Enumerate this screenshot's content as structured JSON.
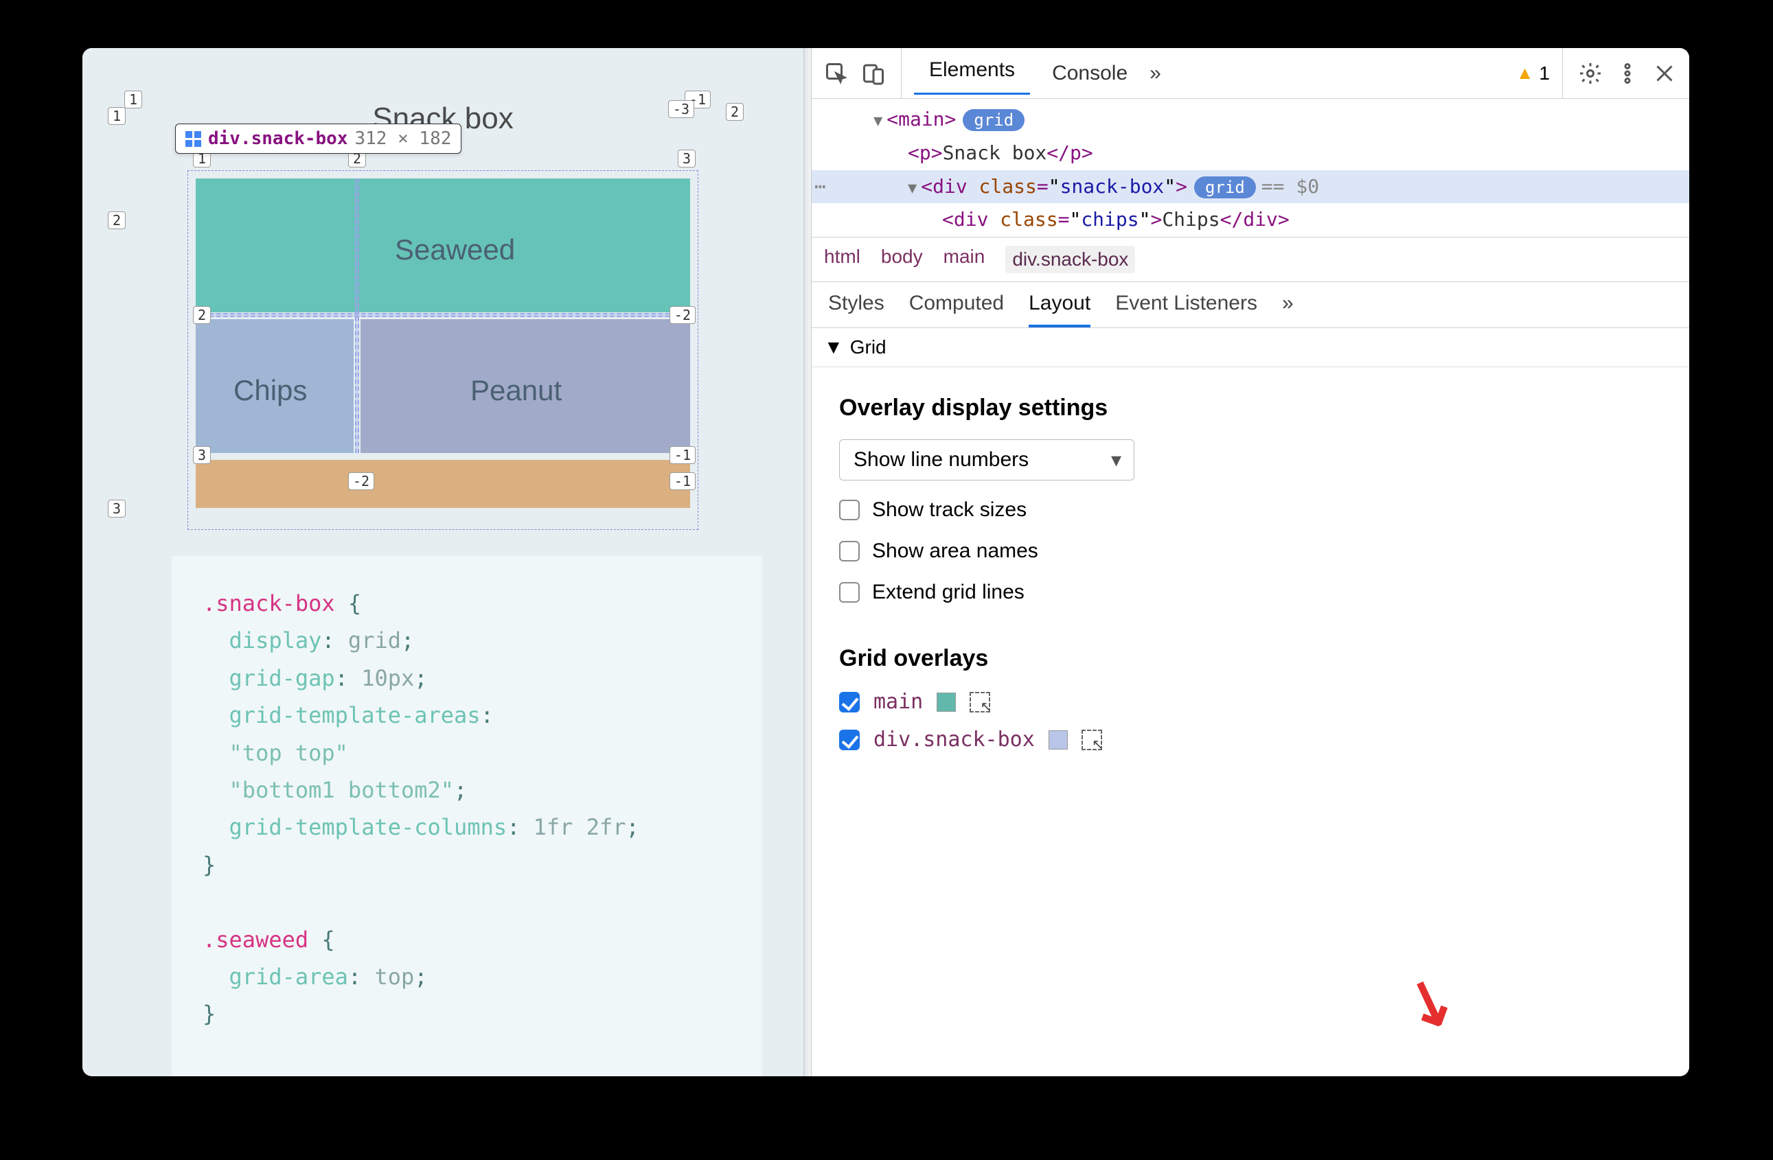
{
  "left": {
    "title": "Snack box",
    "tooltip": {
      "selector": "div.snack-box",
      "dims": "312 × 182"
    },
    "cells": {
      "seaweed": "Seaweed",
      "chips": "Chips",
      "peanut": "Peanut"
    },
    "lineNums": {
      "tl_c": "1",
      "tr_c_neg": "-1",
      "trc_col": "2",
      "r1_row": "1",
      "r2_row": "2",
      "innerTL_c": "1",
      "innerTM_c": "2",
      "innerTR_neg": "-3",
      "innerTR_c": "3",
      "innerML_r": "2",
      "innerMR_neg": "-2",
      "innerBL_r": "3",
      "innerBR_neg": "-1",
      "outerBL_r": "3",
      "outerBM_col": "-2",
      "outerBR_neg": "-1"
    },
    "code": ".snack-box {\n  display: grid;\n  grid-gap: 10px;\n  grid-template-areas:\n  \"top top\"\n  \"bottom1 bottom2\";\n  grid-template-columns: 1fr 2fr;\n}\n\n.seaweed {\n  grid-area: top;\n}"
  },
  "toolbar": {
    "tabs": {
      "elements": "Elements",
      "console": "Console"
    },
    "warnCount": "1"
  },
  "dom": {
    "mainTag": "main",
    "gridBadge": "grid",
    "pOpen": "p",
    "pText": "Snack box",
    "divTag": "div",
    "classAttr": "class",
    "snackClass": "snack-box",
    "eq0": "== $0",
    "chipsClass": "chips",
    "chipsText": "Chips"
  },
  "breadcrumb": [
    "html",
    "body",
    "main",
    "div.snack-box"
  ],
  "subtabs": {
    "styles": "Styles",
    "computed": "Computed",
    "layout": "Layout",
    "events": "Event Listeners"
  },
  "grid": {
    "sectionTitle": "Grid",
    "overlayHeading": "Overlay display settings",
    "selectValue": "Show line numbers",
    "opts": {
      "trackSizes": "Show track sizes",
      "areaNames": "Show area names",
      "extend": "Extend grid lines"
    },
    "overlaysHeading": "Grid overlays",
    "overlays": [
      {
        "name": "main",
        "color": "#63b8ac"
      },
      {
        "name": "div.snack-box",
        "color": "#b9c6ea"
      }
    ]
  }
}
